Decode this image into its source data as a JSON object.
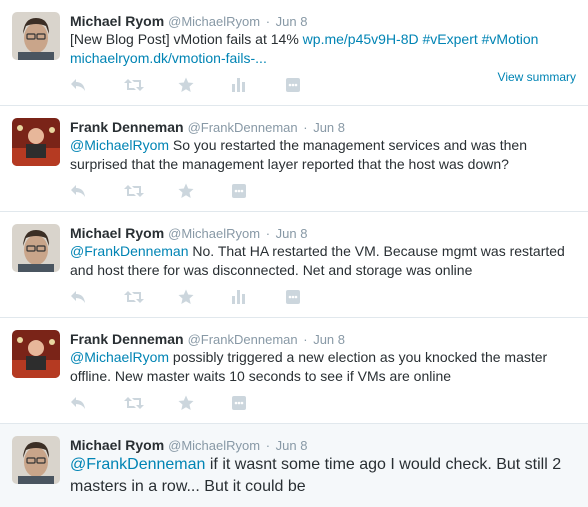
{
  "tweets": [
    {
      "fullname": "Michael Ryom",
      "username": "@MichaelRyom",
      "sep": "·",
      "time": "Jun 8",
      "line1_plain": "[New Blog Post] vMotion fails at 14% ",
      "line1_link": "wp.me/p45v9H-8D",
      "line1_tag1": " #vExpert",
      "line1_tag2": " #vMotion",
      "line2_link": "michaelryom.dk/vmotion-fails-...",
      "view_summary": "View summary"
    },
    {
      "fullname": "Frank Denneman",
      "username": "@FrankDenneman",
      "sep": "·",
      "time": "Jun 8",
      "mention": "@MichaelRyom",
      "text": " So you restarted the management services and was then surprised that the management layer reported that the host was down?"
    },
    {
      "fullname": "Michael Ryom",
      "username": "@MichaelRyom",
      "sep": "·",
      "time": "Jun 8",
      "mention": "@FrankDenneman",
      "text": " No. That HA restarted the VM. Because mgmt was restarted and host there for was disconnected. Net and storage was online"
    },
    {
      "fullname": "Frank Denneman",
      "username": "@FrankDenneman",
      "sep": "·",
      "time": "Jun 8",
      "mention": "@MichaelRyom",
      "text": " possibly triggered a new election as you knocked the master offline. New master waits 10 seconds to see if VMs are online"
    },
    {
      "fullname": "Michael Ryom",
      "username": "@MichaelRyom",
      "sep": "·",
      "time": "Jun 8",
      "mention": "@FrankDenneman",
      "text": " if it wasnt some time ago I would check. But still 2 masters in a row... But it could be"
    }
  ],
  "icons": [
    "reply-icon",
    "retweet-icon",
    "favorite-icon",
    "analytics-icon",
    "more-icon"
  ],
  "colors": {
    "link": "#0084b4",
    "meta": "#8899a6",
    "icon": "#ccd6dd",
    "border": "#e1e8ed",
    "expanded_bg": "#f5f8fa"
  }
}
